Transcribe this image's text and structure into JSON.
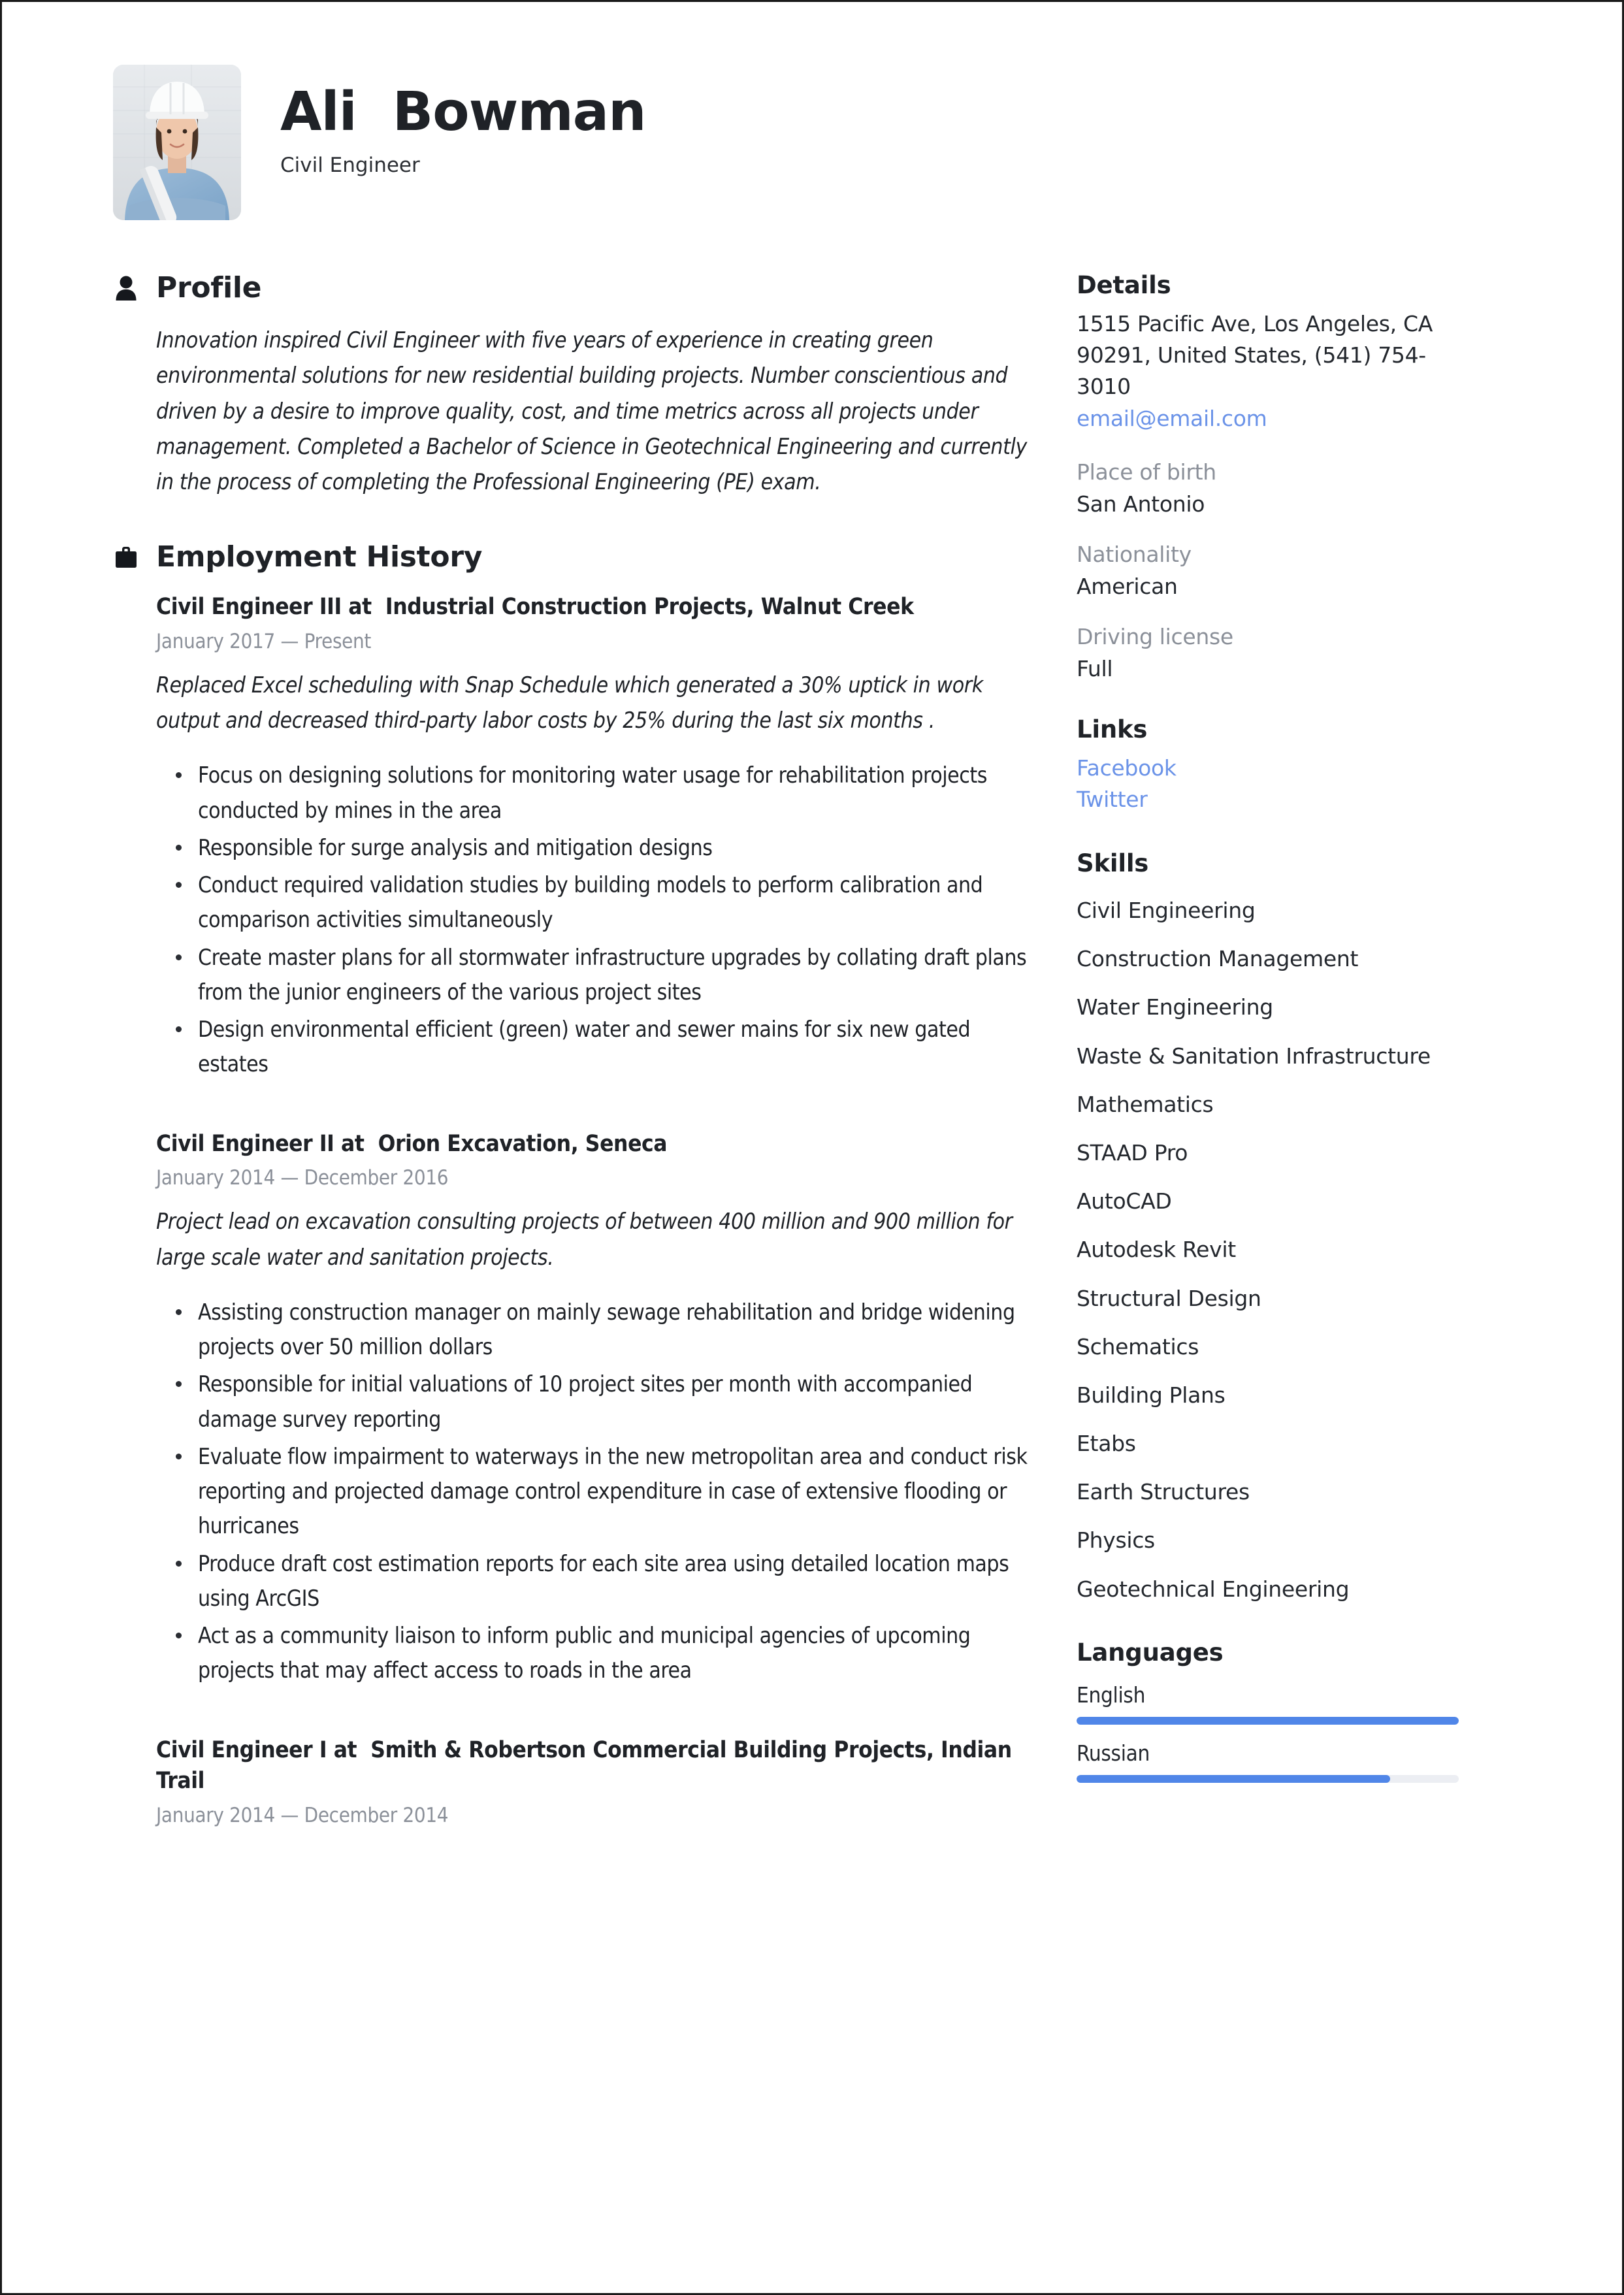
{
  "header": {
    "name": "Ali  Bowman",
    "job_title": "Civil Engineer",
    "avatar_alt": "portrait-photo-female-engineer-hardhat"
  },
  "profile": {
    "section_title": "Profile",
    "icon": "person-icon",
    "text": "Innovation inspired Civil Engineer with five years of experience in creating green environmental solutions for new residential building projects. Number conscientious and driven by a desire to improve quality, cost, and time metrics across all projects under management. Completed a Bachelor of Science in Geotechnical Engineering and currently in the process of completing the Professional Engineering (PE) exam."
  },
  "employment": {
    "section_title": "Employment History",
    "icon": "briefcase-icon",
    "jobs": [
      {
        "title": "Civil Engineer III at  Industrial Construction Projects, Walnut Creek",
        "dates": "January 2017 — Present",
        "summary": "Replaced Excel scheduling with Snap Schedule which generated a 30% uptick in work output and decreased third-party labor costs by 25% during the last six months .",
        "bullets": [
          "Focus on designing solutions for monitoring water usage for rehabilitation projects conducted by mines in the area",
          "Responsible for surge analysis and mitigation designs",
          "Conduct required validation studies by building models to perform calibration and comparison activities simultaneously",
          "Create master plans for all stormwater infrastructure upgrades by collating draft plans from the junior engineers of the various project sites",
          "Design environmental efficient (green) water and sewer mains for six new gated estates"
        ]
      },
      {
        "title": "Civil Engineer II at  Orion Excavation, Seneca",
        "dates": "January 2014 — December 2016",
        "summary": "Project lead on excavation consulting projects of between 400 million and 900 million for large scale water and sanitation projects.",
        "bullets": [
          "Assisting construction manager on mainly sewage rehabilitation and bridge widening projects over 50 million dollars",
          "Responsible for initial valuations of 10 project sites per month with accompanied damage survey reporting",
          "Evaluate flow impairment to waterways in the new metropolitan area and conduct risk reporting and projected damage control expenditure in case of extensive flooding or hurricanes",
          "Produce draft cost estimation reports for each site area using detailed location maps using ArcGIS",
          "Act as a community liaison to inform public and municipal agencies of upcoming projects that may affect access to roads in the area"
        ]
      },
      {
        "title": "Civil Engineer I at  Smith & Robertson Commercial Building Projects, Indian Trail",
        "dates": "January 2014 — December 2014",
        "summary": "",
        "bullets": []
      }
    ]
  },
  "details": {
    "section_title": "Details",
    "address": "1515 Pacific Ave, Los Angeles, CA 90291, United States, (541) 754-3010",
    "email": "email@email.com",
    "fields": [
      {
        "label": "Place of birth",
        "value": "San Antonio"
      },
      {
        "label": "Nationality",
        "value": "American"
      },
      {
        "label": "Driving license",
        "value": "Full"
      }
    ]
  },
  "links": {
    "section_title": "Links",
    "items": [
      "Facebook",
      "Twitter"
    ]
  },
  "skills": {
    "section_title": "Skills",
    "items": [
      "Civil Engineering",
      "Construction Management",
      "Water Engineering",
      "Waste & Sanitation Infrastructure",
      "Mathematics",
      "STAAD Pro",
      "AutoCAD",
      "Autodesk Revit",
      "Structural Design",
      "Schematics",
      "Building Plans",
      "Etabs",
      "Earth Structures",
      "Physics",
      "Geotechnical Engineering"
    ]
  },
  "languages": {
    "section_title": "Languages",
    "items": [
      {
        "name": "English",
        "level_percent": 100
      },
      {
        "name": "Russian",
        "level_percent": 82
      }
    ]
  },
  "colors": {
    "accent_blue": "#5086e8",
    "link_blue": "#6b93e8",
    "text_dark": "#1f2227",
    "text_muted": "#8b9099",
    "track_grey": "#eceef3"
  }
}
